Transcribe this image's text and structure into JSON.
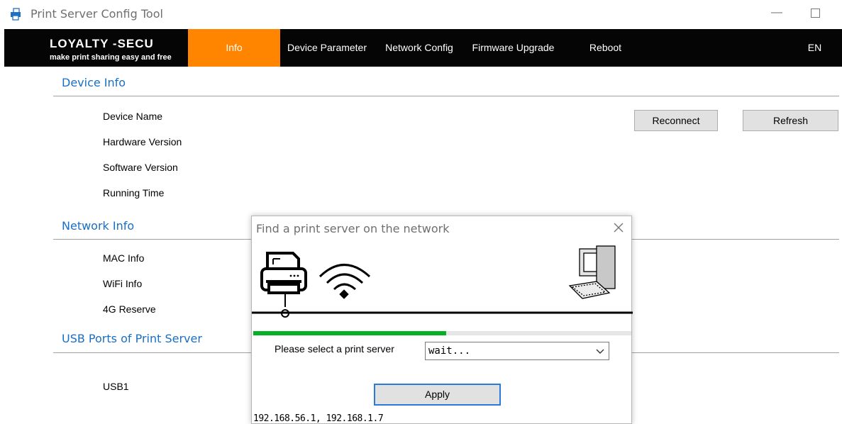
{
  "window": {
    "title": "Print Server Config Tool",
    "minimize_label": "—"
  },
  "brand": {
    "name": "LOYALTY -SECU",
    "tagline": "make print sharing easy and free"
  },
  "nav": {
    "tabs": [
      {
        "label": "Info",
        "active": true
      },
      {
        "label": "Device Parameter",
        "active": false
      },
      {
        "label": "Network Config",
        "active": false
      },
      {
        "label": "Firmware Upgrade",
        "active": false
      },
      {
        "label": "Reboot",
        "active": false
      }
    ],
    "language": "EN"
  },
  "device_info": {
    "title": "Device Info",
    "fields": [
      "Device Name",
      "Hardware Version",
      "Software Version",
      "Running Time"
    ],
    "reconnect_label": "Reconnect",
    "refresh_label": "Refresh"
  },
  "network_info": {
    "title": "Network Info",
    "fields": [
      "MAC Info",
      "WiFi Info",
      "4G Reserve"
    ]
  },
  "usb_ports": {
    "title": "USB Ports of Print Server",
    "fields": [
      "USB1"
    ]
  },
  "dialog": {
    "title": "Find a print server on the network",
    "progress": 0.51,
    "select_label": "Please select a print server",
    "select_value": "wait...",
    "apply_label": "Apply",
    "ip_addresses": "192.168.56.1, 192.168.1.7"
  },
  "colors": {
    "nav_background": "#050505",
    "active_tab": "#ff8400",
    "section_title": "#1a6fc2",
    "progress": "#06b025",
    "apply_border": "#2a7ad8"
  },
  "icons": [
    "app-icon",
    "printer-icon",
    "wifi-icon",
    "computer-icon",
    "close-icon",
    "chevron-down-icon"
  ]
}
